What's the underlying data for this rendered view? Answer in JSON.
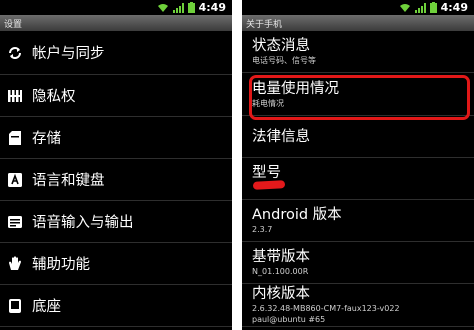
{
  "left_screen": {
    "status": {
      "time": "4:49"
    },
    "title": "设置",
    "menu": [
      {
        "label": "帐户与同步",
        "icon": "sync-icon"
      },
      {
        "label": "隐私权",
        "icon": "privacy-icon"
      },
      {
        "label": "存储",
        "icon": "storage-icon"
      },
      {
        "label": "语言和键盘",
        "icon": "keyboard-icon"
      },
      {
        "label": "语音输入与输出",
        "icon": "voice-icon"
      },
      {
        "label": "辅助功能",
        "icon": "accessibility-hand-icon"
      },
      {
        "label": "底座",
        "icon": "dock-icon"
      }
    ]
  },
  "right_screen": {
    "status": {
      "time": "4:49"
    },
    "title": "关于手机",
    "items": [
      {
        "title": "状态消息",
        "subtitle": "电话号码、信号等"
      },
      {
        "title": "电量使用情况",
        "subtitle": "耗电情况"
      },
      {
        "title": "法律信息",
        "subtitle": ""
      },
      {
        "title": "型号",
        "subtitle": ""
      },
      {
        "title": "Android 版本",
        "subtitle": "2.3.7"
      },
      {
        "title": "基带版本",
        "subtitle": "N_01.100.00R"
      },
      {
        "title": "内核版本",
        "subtitle": "2.6.32.48-MB860-CM7-faux123-v022",
        "subtitle2": "paul@ubuntu #65"
      }
    ]
  },
  "colors": {
    "highlight": "#e11818",
    "status_icon": "#6fd13b",
    "background": "#000000"
  }
}
